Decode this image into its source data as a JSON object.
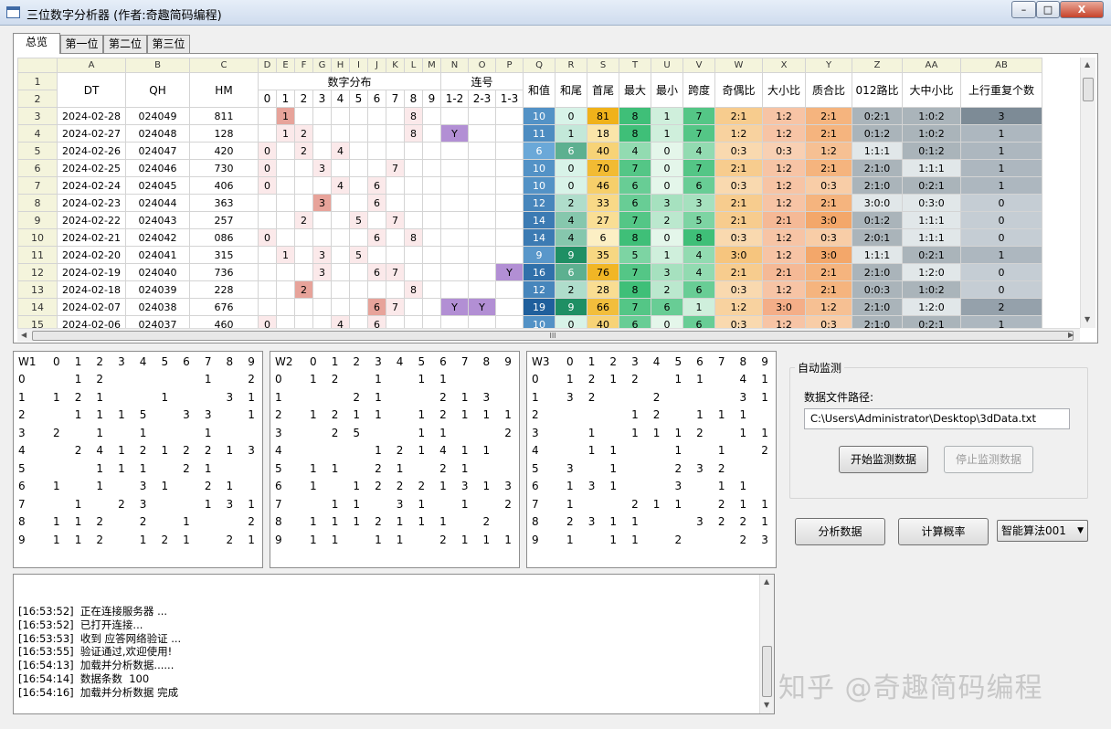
{
  "window": {
    "title": "三位数字分析器 (作者:奇趣简码编程)",
    "min": "–",
    "max": "□",
    "close": "X"
  },
  "tabs": [
    "总览",
    "第一位",
    "第二位",
    "第三位"
  ],
  "grid": {
    "col_letters": [
      "A",
      "B",
      "C",
      "D",
      "E",
      "F",
      "G",
      "H",
      "I",
      "J",
      "K",
      "L",
      "M",
      "N",
      "O",
      "P",
      "Q",
      "R",
      "S",
      "T",
      "U",
      "V",
      "W",
      "X",
      "Y",
      "Z",
      "AA",
      "AB"
    ],
    "row_numbers": [
      "1",
      "2",
      "3",
      "4",
      "5",
      "6",
      "7",
      "8",
      "9",
      "10",
      "11",
      "12",
      "13",
      "14",
      "15"
    ],
    "hdr_dt": "DT",
    "hdr_qh": "QH",
    "hdr_hm": "HM",
    "hdr_digits": "数字分布",
    "digit_labels": [
      "0",
      "1",
      "2",
      "3",
      "4",
      "5",
      "6",
      "7",
      "8",
      "9"
    ],
    "hdr_lianhao": "连号",
    "lianhao_labels": [
      "1-2",
      "2-3",
      "1-3"
    ],
    "stat_labels": [
      "和值",
      "和尾",
      "首尾",
      "最大",
      "最小",
      "跨度",
      "奇偶比",
      "大小比",
      "质合比",
      "012路比",
      "大中小比",
      "上行重复个数"
    ],
    "rows": [
      {
        "dt": "2024-02-28",
        "qh": "024049",
        "hm": "811",
        "d": [
          "",
          "1",
          "",
          "",
          "",
          "",
          "",
          "",
          "8",
          ""
        ],
        "lh": [
          "",
          "",
          ""
        ],
        "s": [
          "10",
          "0",
          "81",
          "8",
          "1",
          "7",
          "2:1",
          "1:2",
          "2:1",
          "0:2:1",
          "1:0:2",
          "3"
        ]
      },
      {
        "dt": "2024-02-27",
        "qh": "024048",
        "hm": "128",
        "d": [
          "",
          "1",
          "2",
          "",
          "",
          "",
          "",
          "",
          "8",
          ""
        ],
        "lh": [
          "Y",
          "",
          ""
        ],
        "s": [
          "11",
          "1",
          "18",
          "8",
          "1",
          "7",
          "1:2",
          "1:2",
          "2:1",
          "0:1:2",
          "1:0:2",
          "1"
        ]
      },
      {
        "dt": "2024-02-26",
        "qh": "024047",
        "hm": "420",
        "d": [
          "0",
          "",
          "2",
          "",
          "4",
          "",
          "",
          "",
          "",
          ""
        ],
        "lh": [
          "",
          "",
          ""
        ],
        "s": [
          "6",
          "6",
          "40",
          "4",
          "0",
          "4",
          "0:3",
          "0:3",
          "1:2",
          "1:1:1",
          "0:1:2",
          "1"
        ]
      },
      {
        "dt": "2024-02-25",
        "qh": "024046",
        "hm": "730",
        "d": [
          "0",
          "",
          "",
          "3",
          "",
          "",
          "",
          "7",
          "",
          ""
        ],
        "lh": [
          "",
          "",
          ""
        ],
        "s": [
          "10",
          "0",
          "70",
          "7",
          "0",
          "7",
          "2:1",
          "1:2",
          "2:1",
          "2:1:0",
          "1:1:1",
          "1"
        ]
      },
      {
        "dt": "2024-02-24",
        "qh": "024045",
        "hm": "406",
        "d": [
          "0",
          "",
          "",
          "",
          "4",
          "",
          "6",
          "",
          "",
          ""
        ],
        "lh": [
          "",
          "",
          ""
        ],
        "s": [
          "10",
          "0",
          "46",
          "6",
          "0",
          "6",
          "0:3",
          "1:2",
          "0:3",
          "2:1:0",
          "0:2:1",
          "1"
        ]
      },
      {
        "dt": "2024-02-23",
        "qh": "024044",
        "hm": "363",
        "d": [
          "",
          "",
          "",
          "3",
          "",
          "",
          "6",
          "",
          "",
          ""
        ],
        "lh": [
          "",
          "",
          ""
        ],
        "s": [
          "12",
          "2",
          "33",
          "6",
          "3",
          "3",
          "2:1",
          "1:2",
          "2:1",
          "3:0:0",
          "0:3:0",
          "0"
        ]
      },
      {
        "dt": "2024-02-22",
        "qh": "024043",
        "hm": "257",
        "d": [
          "",
          "",
          "2",
          "",
          "",
          "5",
          "",
          "7",
          "",
          ""
        ],
        "lh": [
          "",
          "",
          ""
        ],
        "s": [
          "14",
          "4",
          "27",
          "7",
          "2",
          "5",
          "2:1",
          "2:1",
          "3:0",
          "0:1:2",
          "1:1:1",
          "0"
        ]
      },
      {
        "dt": "2024-02-21",
        "qh": "024042",
        "hm": "086",
        "d": [
          "0",
          "",
          "",
          "",
          "",
          "",
          "6",
          "",
          "8",
          ""
        ],
        "lh": [
          "",
          "",
          ""
        ],
        "s": [
          "14",
          "4",
          "6",
          "8",
          "0",
          "8",
          "0:3",
          "1:2",
          "0:3",
          "2:0:1",
          "1:1:1",
          "0"
        ]
      },
      {
        "dt": "2024-02-20",
        "qh": "024041",
        "hm": "315",
        "d": [
          "",
          "1",
          "",
          "3",
          "",
          "5",
          "",
          "",
          "",
          ""
        ],
        "lh": [
          "",
          "",
          ""
        ],
        "s": [
          "9",
          "9",
          "35",
          "5",
          "1",
          "4",
          "3:0",
          "1:2",
          "3:0",
          "1:1:1",
          "0:2:1",
          "1"
        ]
      },
      {
        "dt": "2024-02-19",
        "qh": "024040",
        "hm": "736",
        "d": [
          "",
          "",
          "",
          "3",
          "",
          "",
          "6",
          "7",
          "",
          ""
        ],
        "lh": [
          "",
          "",
          "Y"
        ],
        "s": [
          "16",
          "6",
          "76",
          "7",
          "3",
          "4",
          "2:1",
          "2:1",
          "2:1",
          "2:1:0",
          "1:2:0",
          "0"
        ]
      },
      {
        "dt": "2024-02-18",
        "qh": "024039",
        "hm": "228",
        "d": [
          "",
          "",
          "2",
          "",
          "",
          "",
          "",
          "",
          "8",
          ""
        ],
        "lh": [
          "",
          "",
          ""
        ],
        "s": [
          "12",
          "2",
          "28",
          "8",
          "2",
          "6",
          "0:3",
          "1:2",
          "2:1",
          "0:0:3",
          "1:0:2",
          "0"
        ]
      },
      {
        "dt": "2024-02-07",
        "qh": "024038",
        "hm": "676",
        "d": [
          "",
          "",
          "",
          "",
          "",
          "",
          "6",
          "7",
          "",
          ""
        ],
        "lh": [
          "Y",
          "Y",
          ""
        ],
        "s": [
          "19",
          "9",
          "66",
          "7",
          "6",
          "1",
          "1:2",
          "3:0",
          "1:2",
          "2:1:0",
          "1:2:0",
          "2"
        ]
      },
      {
        "dt": "2024-02-06",
        "qh": "024037",
        "hm": "460",
        "d": [
          "0",
          "",
          "",
          "",
          "4",
          "",
          "6",
          "",
          "",
          ""
        ],
        "lh": [
          "",
          "",
          ""
        ],
        "s": [
          "10",
          "0",
          "40",
          "6",
          "0",
          "6",
          "0:3",
          "1:2",
          "0:3",
          "2:1:0",
          "0:2:1",
          "1"
        ]
      }
    ]
  },
  "hscroll_grip": "III",
  "panels": [
    {
      "title": "W1",
      "cols": [
        "0",
        "1",
        "2",
        "3",
        "4",
        "5",
        "6",
        "7",
        "8",
        "9"
      ],
      "rows": [
        [
          "0",
          "",
          "1",
          "2",
          "",
          "",
          "",
          "",
          "1",
          "",
          "2"
        ],
        [
          "1",
          "1",
          "2",
          "1",
          "",
          "",
          "1",
          "",
          "",
          "3",
          "1"
        ],
        [
          "2",
          "",
          "1",
          "1",
          "1",
          "5",
          "",
          "3",
          "3",
          "",
          "1"
        ],
        [
          "3",
          "2",
          "",
          "1",
          "",
          "1",
          "",
          "",
          "1",
          "",
          ""
        ],
        [
          "4",
          "",
          "2",
          "4",
          "1",
          "2",
          "1",
          "2",
          "2",
          "1",
          "3"
        ],
        [
          "5",
          "",
          "",
          "1",
          "1",
          "1",
          "",
          "2",
          "1",
          "",
          ""
        ],
        [
          "6",
          "1",
          "",
          "1",
          "",
          "3",
          "1",
          "",
          "2",
          "1",
          ""
        ],
        [
          "7",
          "",
          "1",
          "",
          "2",
          "3",
          "",
          "",
          "1",
          "3",
          "1"
        ],
        [
          "8",
          "1",
          "1",
          "2",
          "",
          "2",
          "",
          "1",
          "",
          "",
          "2"
        ],
        [
          "9",
          "1",
          "1",
          "2",
          "",
          "1",
          "2",
          "1",
          "",
          "2",
          "1"
        ]
      ]
    },
    {
      "title": "W2",
      "cols": [
        "0",
        "1",
        "2",
        "3",
        "4",
        "5",
        "6",
        "7",
        "8",
        "9"
      ],
      "rows": [
        [
          "0",
          "1",
          "2",
          "",
          "1",
          "",
          "1",
          "1",
          "",
          "",
          ""
        ],
        [
          "1",
          "",
          "",
          "2",
          "1",
          "",
          "",
          "2",
          "1",
          "3",
          ""
        ],
        [
          "2",
          "1",
          "2",
          "1",
          "1",
          "",
          "1",
          "2",
          "1",
          "1",
          "1"
        ],
        [
          "3",
          "",
          "2",
          "5",
          "",
          "",
          "1",
          "1",
          "",
          "",
          "2"
        ],
        [
          "4",
          "",
          "",
          "",
          "1",
          "2",
          "1",
          "4",
          "1",
          "1",
          ""
        ],
        [
          "5",
          "1",
          "1",
          "",
          "2",
          "1",
          "",
          "2",
          "1",
          "",
          ""
        ],
        [
          "6",
          "1",
          "",
          "1",
          "2",
          "2",
          "2",
          "1",
          "3",
          "1",
          "3"
        ],
        [
          "7",
          "",
          "1",
          "1",
          "",
          "3",
          "1",
          "",
          "1",
          "",
          "2"
        ],
        [
          "8",
          "1",
          "1",
          "1",
          "2",
          "1",
          "1",
          "1",
          "",
          "2",
          ""
        ],
        [
          "9",
          "1",
          "1",
          "",
          "1",
          "1",
          "",
          "2",
          "1",
          "1",
          "1"
        ]
      ]
    },
    {
      "title": "W3",
      "cols": [
        "0",
        "1",
        "2",
        "3",
        "4",
        "5",
        "6",
        "7",
        "8",
        "9"
      ],
      "rows": [
        [
          "0",
          "1",
          "2",
          "1",
          "2",
          "",
          "1",
          "1",
          "",
          "4",
          "1"
        ],
        [
          "1",
          "3",
          "2",
          "",
          "",
          "2",
          "",
          "",
          "",
          "3",
          "1"
        ],
        [
          "2",
          "",
          "",
          "",
          "1",
          "2",
          "",
          "1",
          "1",
          "1",
          ""
        ],
        [
          "3",
          "",
          "1",
          "",
          "1",
          "1",
          "1",
          "2",
          "",
          "1",
          "1"
        ],
        [
          "4",
          "",
          "1",
          "1",
          "",
          "",
          "1",
          "",
          "1",
          "",
          "2"
        ],
        [
          "5",
          "3",
          "",
          "1",
          "",
          "",
          "2",
          "3",
          "2",
          "",
          ""
        ],
        [
          "6",
          "1",
          "3",
          "1",
          "",
          "",
          "3",
          "",
          "1",
          "1",
          ""
        ],
        [
          "7",
          "1",
          "",
          "",
          "2",
          "1",
          "1",
          "",
          "2",
          "1",
          "1"
        ],
        [
          "8",
          "2",
          "3",
          "1",
          "1",
          "",
          "",
          "3",
          "2",
          "2",
          "1"
        ],
        [
          "9",
          "1",
          "",
          "1",
          "1",
          "",
          "2",
          "",
          "",
          "2",
          "3"
        ]
      ]
    }
  ],
  "log": [
    "[16:53:52]  正在连接服务器 ...",
    "[16:53:52]  已打开连接...",
    "[16:53:53]  收到 应答网络验证 ...",
    "[16:53:55]  验证通过,欢迎使用!",
    "[16:54:13]  加载并分析数据......",
    "[16:54:14]  数据条数  100",
    "[16:54:16]  加载并分析数据 完成"
  ],
  "monitor": {
    "group_title": "自动监测",
    "path_label": "数据文件路径:",
    "path_value": "C:\\Users\\Administrator\\Desktop\\3dData.txt",
    "start": "开始监测数据",
    "stop": "停止监测数据"
  },
  "actions": {
    "analyze": "分析数据",
    "probability": "计算概率",
    "algorithm": "智能算法001"
  },
  "watermark": "知乎 @奇趣简码编程"
}
